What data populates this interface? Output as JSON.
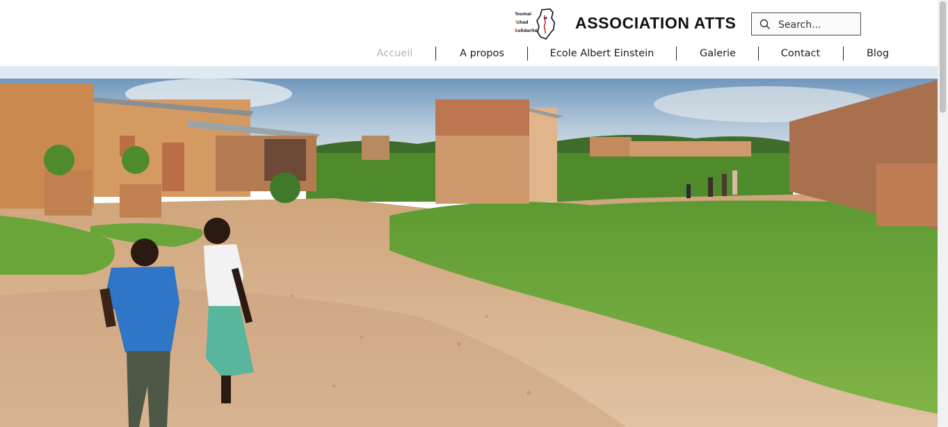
{
  "header": {
    "logo": {
      "alt": "Toumaï Tchad Solidarité logo",
      "lines": [
        "Toumaï",
        "Tchad",
        "Solidarité"
      ],
      "icon": "chad-map-icon"
    },
    "site_title": "ASSOCIATION ATTS",
    "search": {
      "placeholder": "Search...",
      "value": "",
      "icon": "search-icon"
    }
  },
  "nav": {
    "items": [
      {
        "label": "Accueil",
        "active": true
      },
      {
        "label": "A propos",
        "active": false
      },
      {
        "label": "Ecole Albert Einstein",
        "active": false
      },
      {
        "label": "Galerie",
        "active": false
      },
      {
        "label": "Contact",
        "active": false
      },
      {
        "label": "Blog",
        "active": false
      }
    ],
    "active_color": "#b5b5b5",
    "text_color": "#1c1c1c"
  },
  "hero": {
    "alt": "Two children walking on a dirt road between brick buildings and green grass in a Chad village"
  },
  "colors": {
    "title": "#111111",
    "sky": "#8fb3d2",
    "grass": "#6da83a",
    "brick": "#c98a55",
    "dirt": "#d9b48c"
  }
}
